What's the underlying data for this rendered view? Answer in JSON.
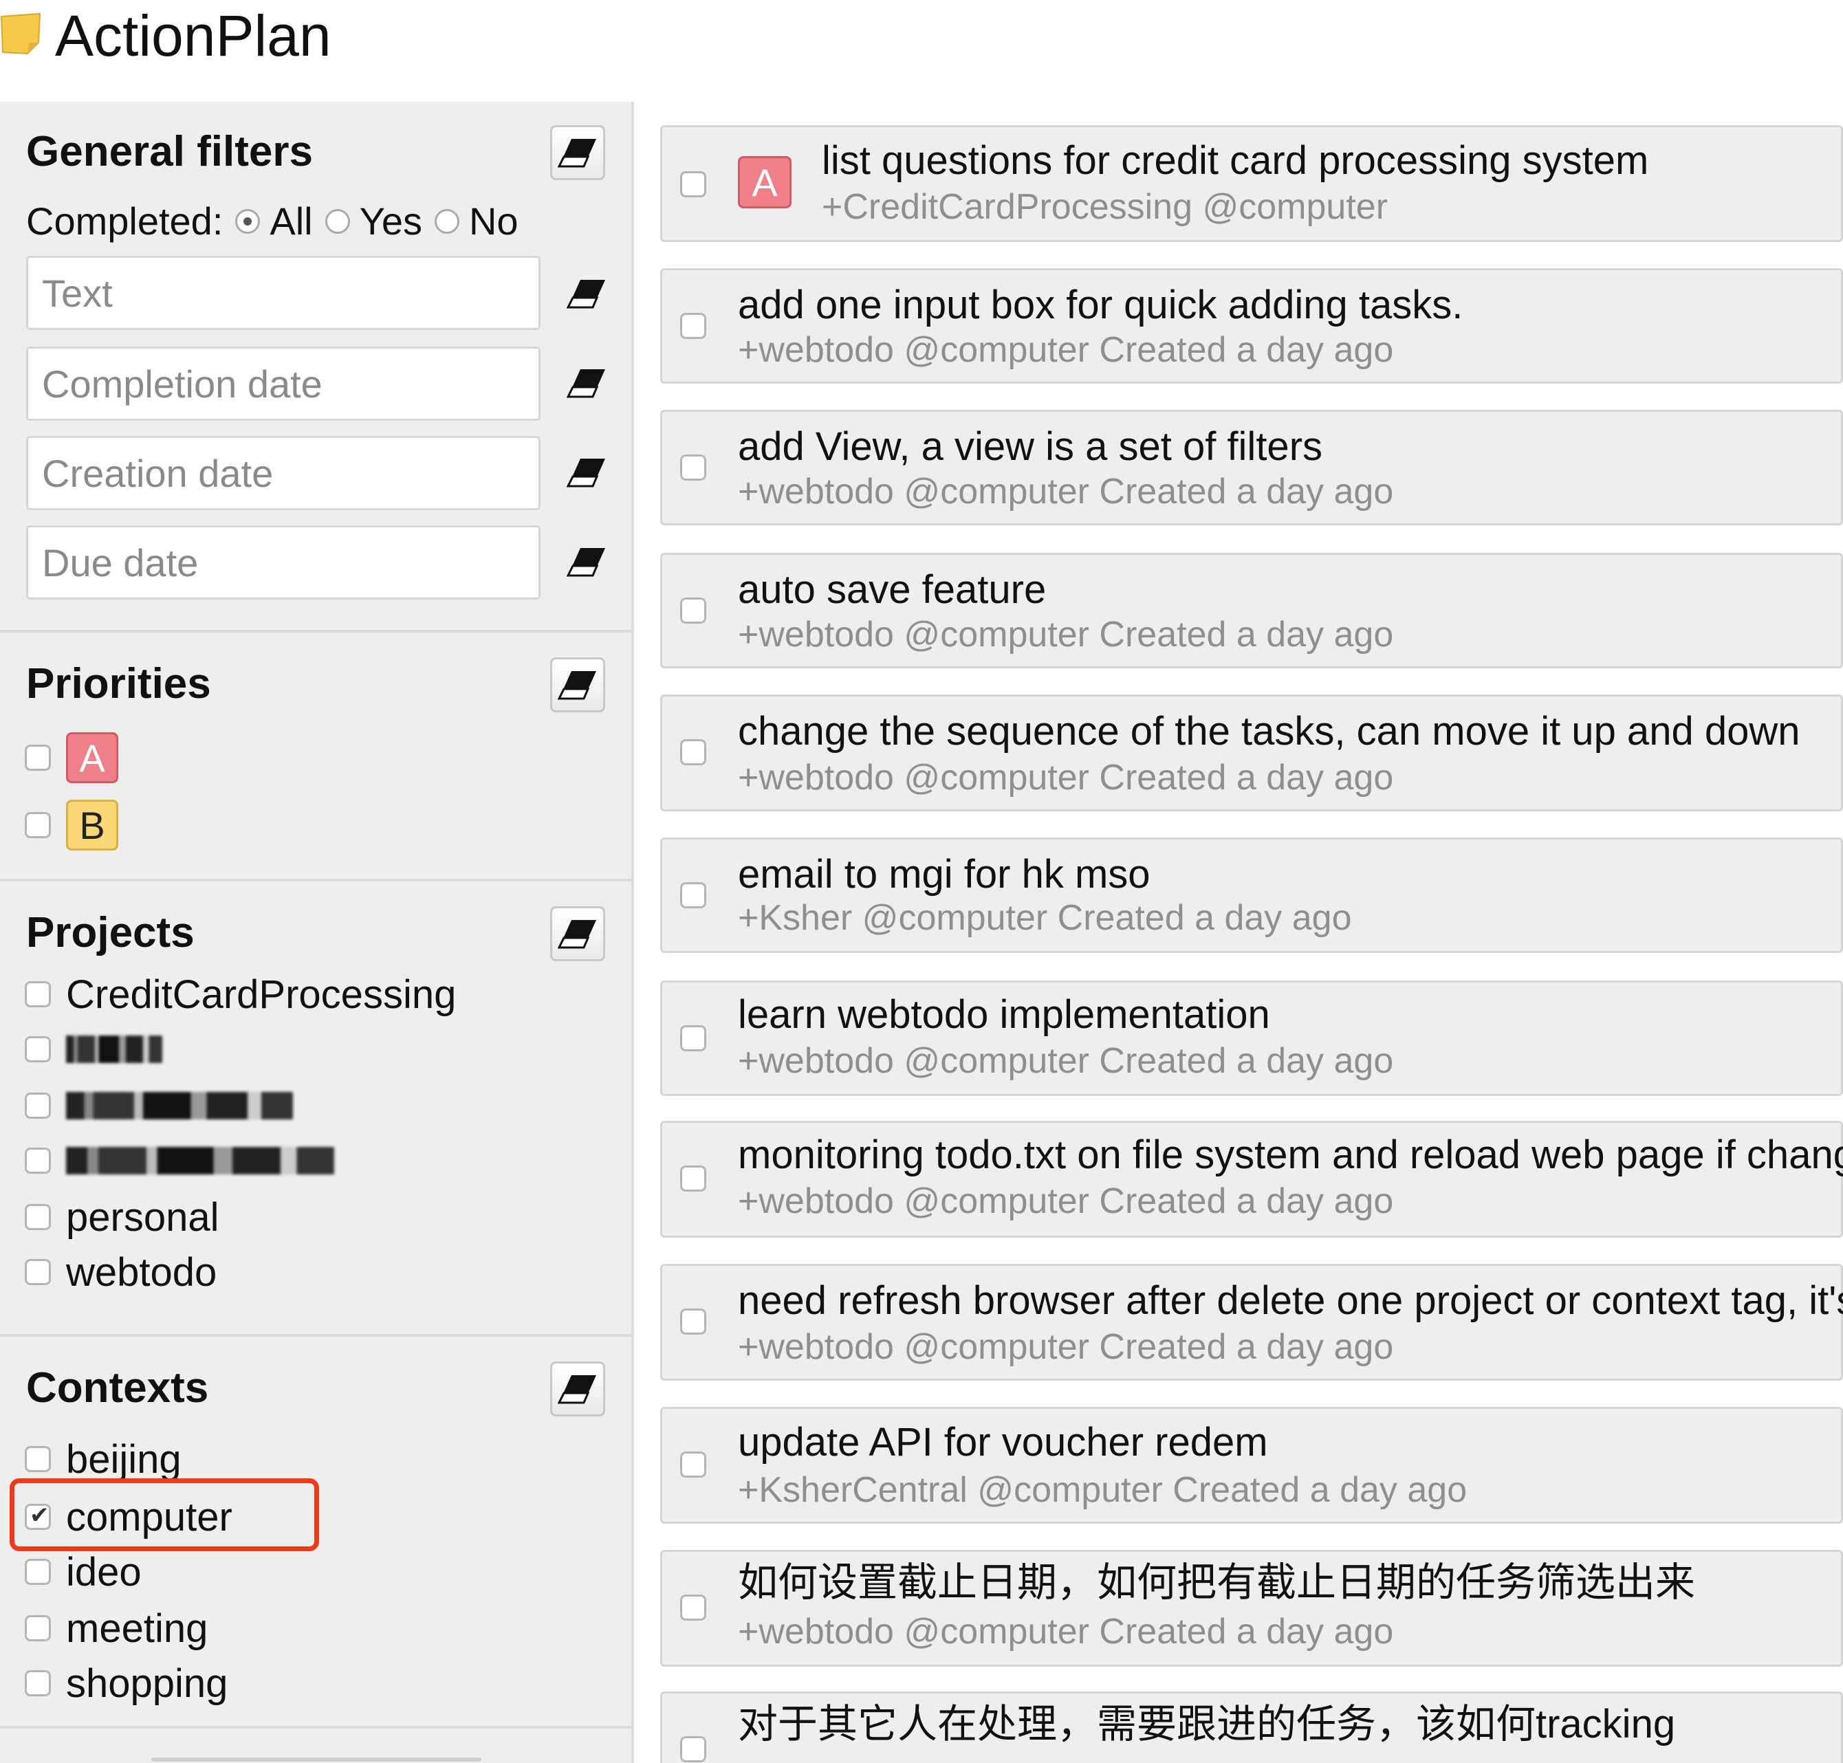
{
  "app": {
    "title": "ActionPlan"
  },
  "general_filters": {
    "title": "General filters",
    "completed_label": "Completed:",
    "options": [
      "All",
      "Yes",
      "No"
    ],
    "selected": "All",
    "inputs": [
      {
        "placeholder": "Text"
      },
      {
        "placeholder": "Completion date"
      },
      {
        "placeholder": "Creation date"
      },
      {
        "placeholder": "Due date"
      }
    ]
  },
  "priorities": {
    "title": "Priorities",
    "items": [
      {
        "label": "A",
        "checked": false,
        "color": "#ef7f88"
      },
      {
        "label": "B",
        "checked": false,
        "color": "#f9d676"
      }
    ]
  },
  "projects": {
    "title": "Projects",
    "items": [
      {
        "label": "CreditCardProcessing",
        "checked": false
      },
      {
        "label": "",
        "checked": false,
        "redacted": true
      },
      {
        "label": "",
        "checked": false,
        "redacted": true
      },
      {
        "label": "",
        "checked": false,
        "redacted": true
      },
      {
        "label": "personal",
        "checked": false
      },
      {
        "label": "webtodo",
        "checked": false
      }
    ]
  },
  "contexts": {
    "title": "Contexts",
    "items": [
      {
        "label": "beijing",
        "checked": false
      },
      {
        "label": "computer",
        "checked": true
      },
      {
        "label": "ideo",
        "checked": false
      },
      {
        "label": "meeting",
        "checked": false
      },
      {
        "label": "shopping",
        "checked": false
      }
    ]
  },
  "tasks": [
    {
      "priority": "A",
      "title": "list questions for credit card processing system",
      "meta": "+CreditCardProcessing @computer"
    },
    {
      "title": "add one input box for quick adding tasks.",
      "meta": "+webtodo @computer Created a day ago"
    },
    {
      "title": "add View, a view is a set of filters",
      "meta": "+webtodo @computer Created a day ago"
    },
    {
      "title": "auto save feature",
      "meta": "+webtodo @computer Created a day ago"
    },
    {
      "title": "change the sequence of the tasks, can move it up and down",
      "meta": "+webtodo @computer Created a day ago"
    },
    {
      "title": "email to mgi for hk mso",
      "meta": "+Ksher @computer Created a day ago"
    },
    {
      "title": "learn webtodo implementation",
      "meta": "+webtodo @computer Created a day ago"
    },
    {
      "title": "monitoring todo.txt on file system and reload web page if change",
      "meta": "+webtodo @computer Created a day ago"
    },
    {
      "title": "need refresh browser after delete one project or context tag, it's",
      "meta": "+webtodo @computer Created a day ago"
    },
    {
      "title": "update API for voucher redem",
      "meta": "+KsherCentral @computer Created a day ago"
    },
    {
      "title": "如何设置截止日期，如何把有截止日期的任务筛选出来",
      "meta": "+webtodo @computer Created a day ago"
    },
    {
      "title": "对于其它人在处理，需要跟进的任务，该如何tracking",
      "meta": ""
    }
  ]
}
